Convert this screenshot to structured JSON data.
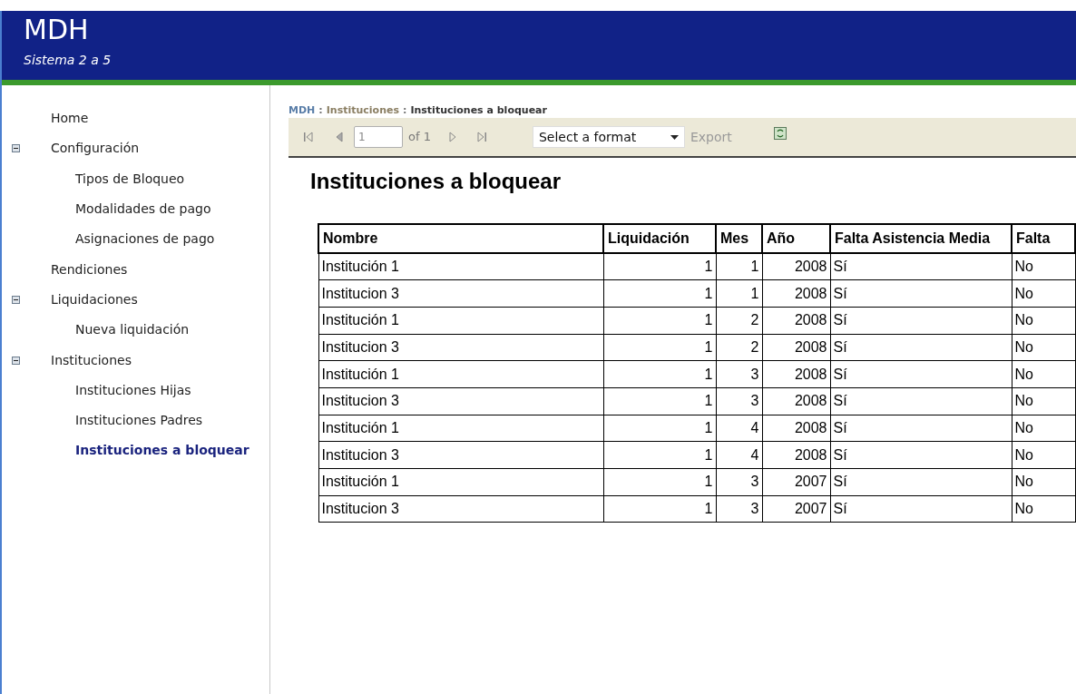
{
  "header": {
    "title": "MDH",
    "subtitle": "Sistema 2 a 5"
  },
  "sidebar": {
    "items": [
      {
        "label": "Home",
        "selected": false
      },
      {
        "label": "Configuración",
        "selected": false,
        "expanded": true,
        "children": [
          {
            "label": "Tipos de Bloqueo",
            "selected": false
          },
          {
            "label": "Modalidades de pago",
            "selected": false
          },
          {
            "label": "Asignaciones de pago",
            "selected": false
          }
        ]
      },
      {
        "label": "Rendiciones",
        "selected": false
      },
      {
        "label": "Liquidaciones",
        "selected": false,
        "expanded": true,
        "children": [
          {
            "label": "Nueva liquidación",
            "selected": false
          }
        ]
      },
      {
        "label": "Instituciones",
        "selected": false,
        "expanded": true,
        "children": [
          {
            "label": "Instituciones Hijas",
            "selected": false
          },
          {
            "label": "Instituciones Padres",
            "selected": false
          },
          {
            "label": "Instituciones a bloquear",
            "selected": true
          }
        ]
      }
    ]
  },
  "breadcrumb": [
    "MDH",
    "Instituciones",
    "Instituciones a bloquear"
  ],
  "breadcrumb_separator": ":",
  "toolbar": {
    "page": "1",
    "of": "of 1",
    "format_placeholder": "Select a format",
    "export": "Export"
  },
  "report": {
    "title": "Instituciones a bloquear",
    "columns": [
      "Nombre",
      "Liquidación",
      "Mes",
      "Año",
      "Falta Asistencia Media",
      "Falta"
    ],
    "rows": [
      [
        "Institución 1",
        "1",
        "1",
        "2008",
        "Sí",
        "No"
      ],
      [
        "Institucion 3",
        "1",
        "1",
        "2008",
        "Sí",
        "No"
      ],
      [
        "Institución 1",
        "1",
        "2",
        "2008",
        "Sí",
        "No"
      ],
      [
        "Institucion 3",
        "1",
        "2",
        "2008",
        "Sí",
        "No"
      ],
      [
        "Institución 1",
        "1",
        "3",
        "2008",
        "Sí",
        "No"
      ],
      [
        "Institucion 3",
        "1",
        "3",
        "2008",
        "Sí",
        "No"
      ],
      [
        "Institución 1",
        "1",
        "4",
        "2008",
        "Sí",
        "No"
      ],
      [
        "Institucion 3",
        "1",
        "4",
        "2008",
        "Sí",
        "No"
      ],
      [
        "Institución 1",
        "1",
        "3",
        "2007",
        "Sí",
        "No"
      ],
      [
        "Institucion 3",
        "1",
        "3",
        "2007",
        "Sí",
        "No"
      ]
    ]
  }
}
